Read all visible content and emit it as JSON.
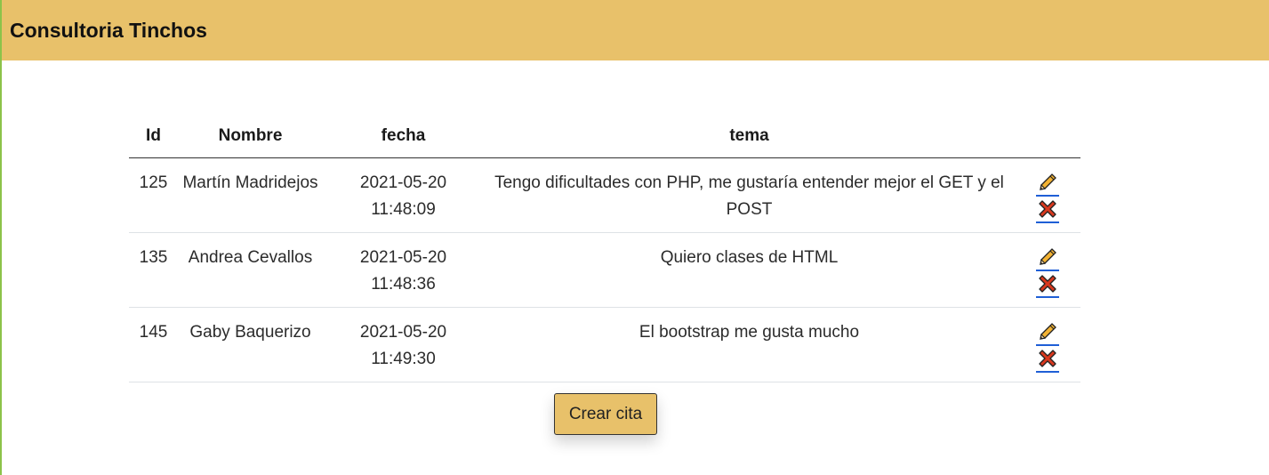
{
  "navbar": {
    "brand": "Consultoria Tinchos"
  },
  "table": {
    "headers": [
      "Id",
      "Nombre",
      "fecha",
      "tema",
      ""
    ],
    "rows": [
      {
        "id": "125",
        "nombre": "Martín Madridejos",
        "fecha_date": "2021-05-20",
        "fecha_time": "11:48:09",
        "tema": "Tengo dificultades con PHP, me gustaría entender mejor el GET y el POST",
        "actions": [
          "pencil-icon",
          "cross-icon"
        ]
      },
      {
        "id": "135",
        "nombre": "Andrea Cevallos",
        "fecha_date": "2021-05-20",
        "fecha_time": "11:48:36",
        "tema": "Quiero clases de HTML",
        "actions": [
          "pencil-icon",
          "cross-icon"
        ]
      },
      {
        "id": "145",
        "nombre": "Gaby Baquerizo",
        "fecha_date": "2021-05-20",
        "fecha_time": "11:49:30",
        "tema": "El bootstrap me gusta mucho",
        "actions": [
          "pencil-icon",
          "cross-icon"
        ]
      }
    ]
  },
  "create_button": {
    "label": "Crear cita"
  },
  "colors": {
    "navbar": "#e8c16a",
    "button": "#e8c16a",
    "link_underline": "#1f5fd6",
    "cross": "#d9381e",
    "pencil": "#f2b233"
  }
}
